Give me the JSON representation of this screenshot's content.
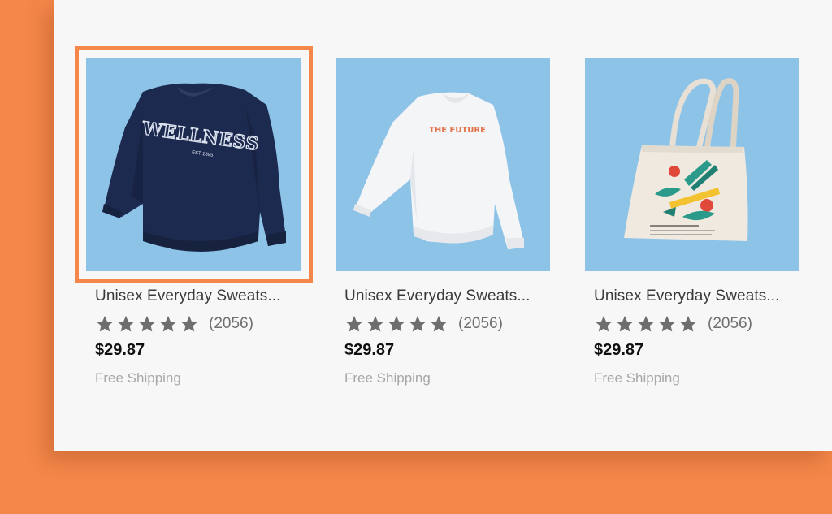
{
  "products": [
    {
      "title": "Unisex Everyday Sweats...",
      "image": "navy-sweatshirt",
      "image_text": "WELLNESS",
      "image_subtext": "EST 1895",
      "rating": 5,
      "review_count": "(2056)",
      "price": "$29.87",
      "shipping": "Free Shipping",
      "selected": true
    },
    {
      "title": "Unisex Everyday Sweats...",
      "image": "white-sweatshirt",
      "image_text": "THE FUTURE",
      "rating": 5,
      "review_count": "(2056)",
      "price": "$29.87",
      "shipping": "Free Shipping",
      "selected": false
    },
    {
      "title": "Unisex Everyday Sweats...",
      "image": "tote-bag",
      "rating": 5,
      "review_count": "(2056)",
      "price": "$29.87",
      "shipping": "Free Shipping",
      "selected": false
    }
  ],
  "colors": {
    "background": "#f5874a",
    "panel": "#f7f7f7",
    "image_bg": "#8ec3e8",
    "star": "#6e6e6e",
    "selection": "#f5874a"
  }
}
